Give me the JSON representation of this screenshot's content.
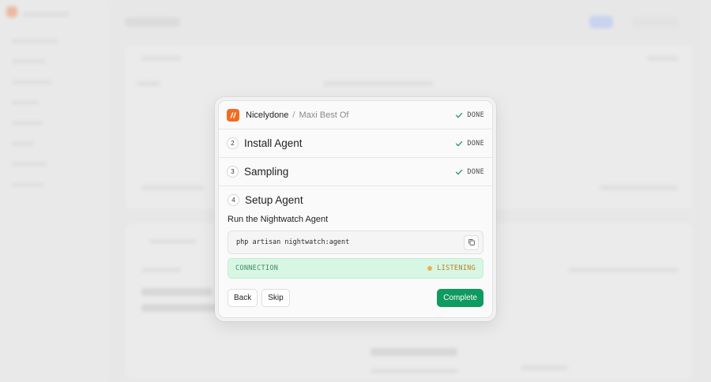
{
  "breadcrumb": {
    "organization": "Nicelydone",
    "separator": "/",
    "project": "Maxi Best Of",
    "status": "DONE"
  },
  "steps": [
    {
      "number": "2",
      "title": "Install Agent",
      "status": "DONE"
    },
    {
      "number": "3",
      "title": "Sampling",
      "status": "DONE"
    }
  ],
  "active_step": {
    "number": "4",
    "title": "Setup Agent",
    "subtitle": "Run the Nightwatch Agent",
    "command": "php artisan nightwatch:agent",
    "connection": {
      "label": "CONNECTION",
      "status": "LISTENING",
      "status_color": "#e7b15a"
    }
  },
  "footer": {
    "back_label": "Back",
    "skip_label": "Skip",
    "complete_label": "Complete"
  },
  "colors": {
    "brand": "#f26b21",
    "primary": "#0f9a5f",
    "success_bg": "#d7f7e4"
  },
  "icons": {
    "logo": "nightwatch-logo-icon",
    "check": "check-icon",
    "copy": "copy-icon"
  }
}
